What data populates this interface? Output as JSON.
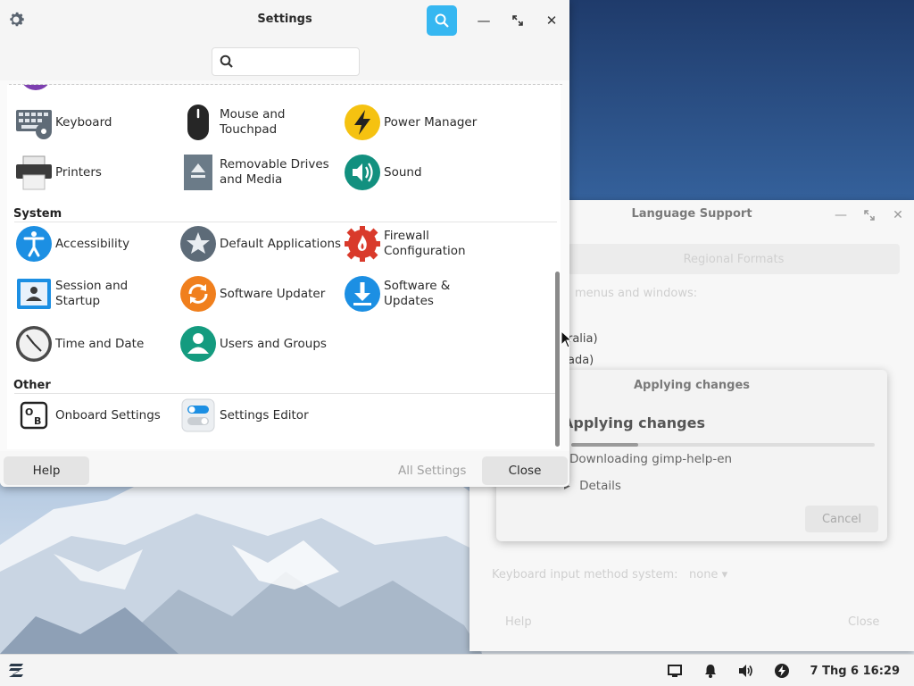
{
  "settings": {
    "title": "Settings",
    "search_placeholder": "",
    "categories": [
      {
        "name": "System"
      },
      {
        "name": "Other"
      }
    ],
    "items": [
      {
        "label": "Keyboard"
      },
      {
        "label": "Mouse and\nTouchpad"
      },
      {
        "label": "Power Manager"
      },
      {
        "label": "Printers"
      },
      {
        "label": "Removable Drives\nand Media"
      },
      {
        "label": "Sound"
      },
      {
        "label": "Accessibility"
      },
      {
        "label": "Default Applications"
      },
      {
        "label": "Firewall\nConfiguration"
      },
      {
        "label": "Session and\nStartup"
      },
      {
        "label": "Software Updater"
      },
      {
        "label": "Software &\nUpdates"
      },
      {
        "label": "Time and Date"
      },
      {
        "label": "Users and Groups"
      },
      {
        "label": "Onboard Settings"
      },
      {
        "label": "Settings Editor"
      }
    ],
    "footer": {
      "help": "Help",
      "all_settings": "All Settings",
      "close": "Close"
    }
  },
  "language_support": {
    "title": "Language Support",
    "tab": "Regional Formats",
    "menus_text": "menus and windows:",
    "list_items": [
      "ralia)",
      "ada)"
    ],
    "keyboard_label": "Keyboard input method system:",
    "keyboard_value": "none",
    "help": "Help",
    "close": "Close"
  },
  "applying": {
    "title": "Applying changes",
    "heading": "Applying changes",
    "status": "Downloading gimp-help-en",
    "details": "Details",
    "cancel": "Cancel",
    "progress": 0.22
  },
  "taskbar": {
    "clock": "7 Thg 6 16:29"
  },
  "colors": {
    "accent": "#36b7f1",
    "power": "#f5c211",
    "sound": "#12907f",
    "firewall": "#d93a2b",
    "updater": "#f07f1d",
    "users": "#149b7f"
  }
}
